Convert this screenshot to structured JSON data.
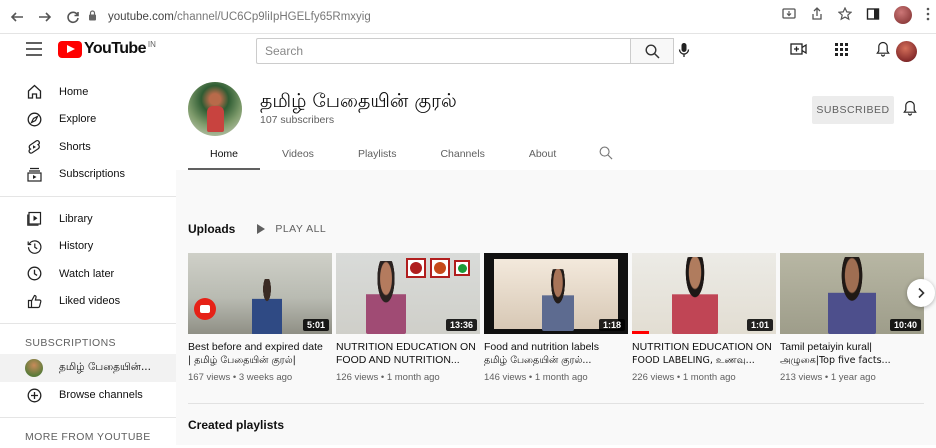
{
  "browser": {
    "url_host": "youtube.com",
    "url_path": "/channel/UC6Cp9liIpHGELfy65Rmxyig"
  },
  "header": {
    "logo_text": "YouTube",
    "logo_country": "IN",
    "search_placeholder": "Search"
  },
  "sidebar": {
    "primary": [
      {
        "label": "Home",
        "icon": "home-icon"
      },
      {
        "label": "Explore",
        "icon": "compass-icon"
      },
      {
        "label": "Shorts",
        "icon": "shorts-icon"
      },
      {
        "label": "Subscriptions",
        "icon": "subscriptions-icon"
      }
    ],
    "secondary": [
      {
        "label": "Library",
        "icon": "library-icon"
      },
      {
        "label": "History",
        "icon": "history-icon"
      },
      {
        "label": "Watch later",
        "icon": "clock-icon"
      },
      {
        "label": "Liked videos",
        "icon": "thumbs-up-icon"
      }
    ],
    "subscriptions_heading": "SUBSCRIPTIONS",
    "subscriptions": [
      {
        "label": "தமிழ் பேதையின்..."
      }
    ],
    "browse_channels": "Browse channels",
    "more_heading": "MORE FROM YOUTUBE"
  },
  "channel": {
    "name": "தமிழ் பேதையின் குரல்",
    "subscribers": "107 subscribers",
    "subscribed_label": "SUBSCRIBED",
    "tabs": [
      {
        "label": "Home",
        "active": true
      },
      {
        "label": "Videos",
        "active": false
      },
      {
        "label": "Playlists",
        "active": false
      },
      {
        "label": "Channels",
        "active": false
      },
      {
        "label": "About",
        "active": false
      }
    ]
  },
  "uploads": {
    "title": "Uploads",
    "play_all": "PLAY ALL",
    "videos": [
      {
        "title_line1": "Best before and expired date",
        "title_line2": "| தமிழ் பேதையின் குரல்|",
        "meta": "167 views • 3 weeks ago",
        "duration": "5:01",
        "progress": 0
      },
      {
        "title_line1": "NUTRITION EDUCATION ON",
        "title_line2": "FOOD AND NUTRITION...",
        "meta": "126 views • 1 month ago",
        "duration": "13:36",
        "progress": 0
      },
      {
        "title_line1": "Food and nutrition labels",
        "title_line2": "தமிழ் பேதையின் குரல்...",
        "meta": "146 views • 1 month ago",
        "duration": "1:18",
        "progress": 0
      },
      {
        "title_line1": "NUTRITION EDUCATION ON",
        "title_line2": "FOOD LABELING, உணவு...",
        "meta": "226 views • 1 month ago",
        "duration": "1:01",
        "progress": 0.12
      },
      {
        "title_line1": "Tamil petaiyin kural|",
        "title_line2": "அழுகை|Top five facts...",
        "meta": "213 views • 1 year ago",
        "duration": "10:40",
        "progress": 0
      }
    ]
  },
  "created_playlists_title": "Created playlists",
  "colors": {
    "brand_red": "#ff0000",
    "thumb2_dots": [
      "#b01e1e",
      "#c64a1a",
      "#1c9c3a"
    ]
  }
}
